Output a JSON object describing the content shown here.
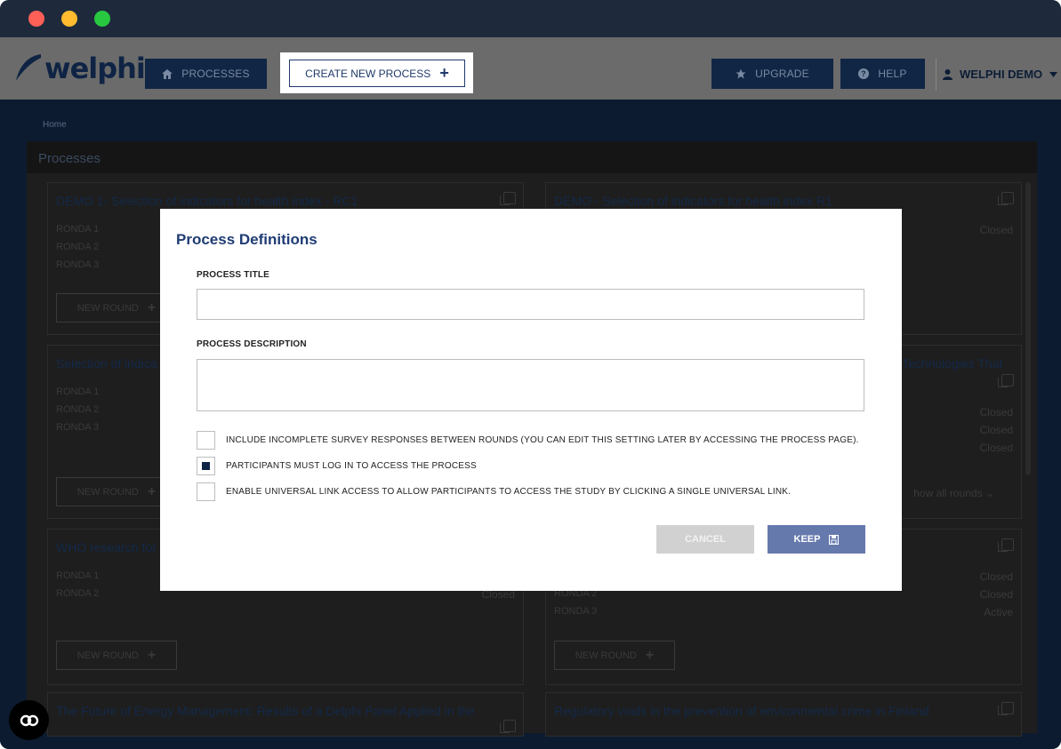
{
  "app": {
    "logo_text": "welphi",
    "nav": {
      "processes": "PROCESSES",
      "create_new_process": "CREATE NEW PROCESS",
      "upgrade": "UPGRADE",
      "help": "HELP",
      "user": "WELPHI DEMO"
    }
  },
  "breadcrumb": "Home",
  "panel_title": "Processes",
  "cards": [
    {
      "title": "DEMO 1- Selection of indicators for health index - RC1",
      "rounds": [
        "RONDA 1",
        "RONDA 2",
        "RONDA 3"
      ],
      "statuses": [],
      "new_round": "NEW ROUND"
    },
    {
      "title": "DEMO - Selection of indicators for health index R1",
      "rounds": [],
      "statuses": [
        "Closed"
      ],
      "new_round": ""
    },
    {
      "title": "Selection of indica",
      "rounds": [
        "RONDA 1",
        "RONDA 2",
        "RONDA 3"
      ],
      "statuses": [],
      "new_round": "NEW ROUND"
    },
    {
      "title": "Technologies That",
      "rounds": [],
      "statuses": [
        "Closed",
        "Closed",
        "Closed"
      ],
      "show_all": "how all rounds"
    },
    {
      "title": "WHO research for",
      "rounds": [
        "RONDA 1",
        "RONDA 2"
      ],
      "statuses": [
        "Closed"
      ],
      "new_round": "NEW ROUND"
    },
    {
      "title": "",
      "rounds": [
        "RONDA 2",
        "RONDA 3"
      ],
      "statuses": [
        "Closed",
        "Closed",
        "Active"
      ],
      "new_round": "NEW ROUND"
    },
    {
      "title": "The Future of Energy Management: Results of a Delphi Panel Applied in the"
    },
    {
      "title": "Regulatory voids in the prevention of environmental crime in Finland"
    }
  ],
  "modal": {
    "title": "Process Definitions",
    "process_title_label": "PROCESS TITLE",
    "process_title_value": "",
    "process_description_label": "PROCESS DESCRIPTION",
    "process_description_value": "",
    "options": [
      {
        "label": "INCLUDE INCOMPLETE SURVEY RESPONSES BETWEEN ROUNDS (YOU CAN EDIT THIS SETTING LATER BY ACCESSING THE PROCESS PAGE).",
        "checked": false
      },
      {
        "label": "PARTICIPANTS MUST LOG IN TO ACCESS THE PROCESS",
        "checked": true
      },
      {
        "label": "ENABLE UNIVERSAL LINK ACCESS TO ALLOW PARTICIPANTS TO ACCESS THE STUDY BY CLICKING A SINGLE UNIVERSAL LINK.",
        "checked": false
      }
    ],
    "cancel": "CANCEL",
    "keep": "KEEP"
  },
  "colors": {
    "navy": "#0f2444",
    "modal_title": "#1f3c73",
    "keep_button": "#6679ad",
    "cancel_button": "#d1d1d1"
  }
}
